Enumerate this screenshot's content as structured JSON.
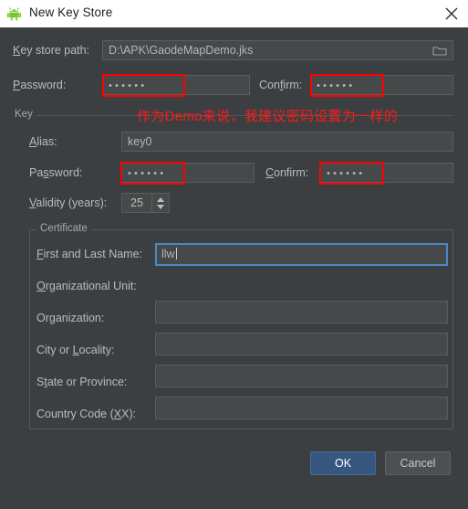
{
  "window": {
    "title": "New Key Store",
    "app_icon": "android-robot-icon",
    "close_icon": "close-icon",
    "accent_blue": "#365880",
    "focus_blue": "#4b88c5",
    "annotation_red": "#ff0000",
    "background": "#3c3f41"
  },
  "keystore": {
    "path_label_pre": "K",
    "path_label_post": "ey store path:",
    "path_value": "D:\\APK\\GaodeMapDemo.jks",
    "browse_icon": "folder-icon",
    "password_label_pre": "P",
    "password_label_post": "assword:",
    "password_value": "••••••",
    "confirm_label_pre": "Con",
    "confirm_label_mid": "f",
    "confirm_label_post": "irm:",
    "confirm_value": "••••••"
  },
  "key_group": {
    "legend": "Key",
    "alias_label_pre": "A",
    "alias_label_post": "lias:",
    "alias_value": "key0",
    "password_label_pre": "Pa",
    "password_label_mid": "s",
    "password_label_post": "sword:",
    "password_value": "••••••",
    "confirm_label_pre": "C",
    "confirm_label_post": "onfirm:",
    "confirm_value": "••••••",
    "validity_label_pre": "V",
    "validity_label_post": "alidity (years):",
    "validity_value": "25"
  },
  "certificate": {
    "legend": "Certificate",
    "rows": [
      {
        "label_pre": "F",
        "label_post": "irst and Last Name:",
        "value": "llw",
        "focused": true
      },
      {
        "label_pre": "O",
        "label_post": "rganizational Unit:",
        "value": "",
        "focused": false
      },
      {
        "label_pre": "Or",
        "label_mid": "g",
        "label_post": "anization:",
        "value": "",
        "focused": false
      },
      {
        "label_pre": "City or ",
        "label_mid": "L",
        "label_post": "ocality:",
        "value": "",
        "focused": false
      },
      {
        "label_pre": "S",
        "label_mid": "t",
        "label_post": "ate or Province:",
        "value": "",
        "focused": false
      },
      {
        "label_pre": "Country Code (",
        "label_mid": "X",
        "label_post": "X):",
        "value": "",
        "focused": false
      }
    ]
  },
  "annotation": {
    "text": "作为Demo来说，我建议密码设置为一样的",
    "boxes": 4
  },
  "buttons": {
    "ok": "OK",
    "cancel": "Cancel"
  }
}
